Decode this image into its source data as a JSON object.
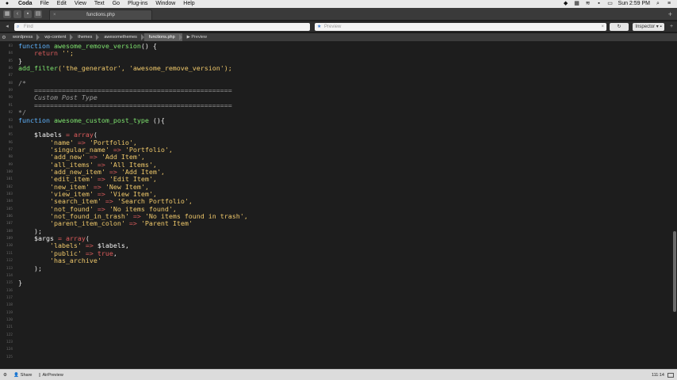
{
  "menubar": {
    "apple": "",
    "items": [
      "Coda",
      "File",
      "Edit",
      "View",
      "Text",
      "Go",
      "Plug-ins",
      "Window",
      "Help"
    ],
    "clock": "Sun 2:59 PM"
  },
  "tabbar": {
    "tab_label": "functions.php",
    "plus": "+"
  },
  "searchbar": {
    "find_placeholder": "Find",
    "preview_placeholder": "Preview",
    "button_label": "Inspector ▾ ▪",
    "plus": "+"
  },
  "breadcrumb": {
    "items": [
      "wordpress",
      "wp-content",
      "themes",
      "awesomethemes",
      "functions.php"
    ],
    "preview_label": "Preview"
  },
  "editor": {
    "line_numbers": [
      "83",
      "84",
      "85",
      "86",
      "87",
      "88",
      "89",
      "90",
      "91",
      "92",
      "93",
      "94",
      "95",
      "96",
      "97",
      "98",
      "99",
      "100",
      "101",
      "102",
      "103",
      "104",
      "105",
      "106",
      "107",
      "108",
      "109",
      "110",
      "111",
      "112",
      "113",
      "114",
      "115",
      "116",
      "117",
      "118",
      "119",
      "120",
      "121",
      "122",
      "123",
      "124",
      "125"
    ],
    "code_lines": [
      [
        {
          "t": "function ",
          "c": "kw"
        },
        {
          "t": "awesome_remove_version",
          "c": "fn"
        },
        {
          "t": "() {",
          "c": "pl"
        }
      ],
      [
        {
          "t": "    return ",
          "c": "op"
        },
        {
          "t": "'';",
          "c": "str"
        }
      ],
      [
        {
          "t": "}",
          "c": "pl"
        }
      ],
      [
        {
          "t": "add_filter",
          "c": "fn"
        },
        {
          "t": "('the_generator', 'awesome_remove_version');",
          "c": "str"
        }
      ],
      [],
      [
        {
          "t": "/*",
          "c": "cm"
        }
      ],
      [
        {
          "t": "    ==================================================",
          "c": "cm"
        }
      ],
      [
        {
          "t": "    Custom Post Type",
          "c": "cm-i"
        }
      ],
      [
        {
          "t": "    ==================================================",
          "c": "cm"
        }
      ],
      [
        {
          "t": "*/",
          "c": "cm"
        }
      ],
      [
        {
          "t": "function ",
          "c": "kw"
        },
        {
          "t": "awesome_custom_post_type ",
          "c": "fn"
        },
        {
          "t": "(){",
          "c": "pl"
        }
      ],
      [],
      [
        {
          "t": "    $labels ",
          "c": "var"
        },
        {
          "t": "= array",
          "c": "arr"
        },
        {
          "t": "(",
          "c": "pl"
        }
      ],
      [
        {
          "t": "        'name' ",
          "c": "str"
        },
        {
          "t": "=> ",
          "c": "op"
        },
        {
          "t": "'Portfolio',",
          "c": "str"
        }
      ],
      [
        {
          "t": "        'singular_name' ",
          "c": "str"
        },
        {
          "t": "=> ",
          "c": "op"
        },
        {
          "t": "'Portfolio',",
          "c": "str"
        }
      ],
      [
        {
          "t": "        'add_new' ",
          "c": "str"
        },
        {
          "t": "=> ",
          "c": "op"
        },
        {
          "t": "'Add Item',",
          "c": "str"
        }
      ],
      [
        {
          "t": "        'all_items' ",
          "c": "str"
        },
        {
          "t": "=> ",
          "c": "op"
        },
        {
          "t": "'All Items',",
          "c": "str"
        }
      ],
      [
        {
          "t": "        'add_new_item' ",
          "c": "str"
        },
        {
          "t": "=> ",
          "c": "op"
        },
        {
          "t": "'Add Item',",
          "c": "str"
        }
      ],
      [
        {
          "t": "        'edit_item' ",
          "c": "str"
        },
        {
          "t": "=> ",
          "c": "op"
        },
        {
          "t": "'Edit Item',",
          "c": "str"
        }
      ],
      [
        {
          "t": "        'new_item' ",
          "c": "str"
        },
        {
          "t": "=> ",
          "c": "op"
        },
        {
          "t": "'New Item',",
          "c": "str"
        }
      ],
      [
        {
          "t": "        'view_item' ",
          "c": "str"
        },
        {
          "t": "=> ",
          "c": "op"
        },
        {
          "t": "'View Item',",
          "c": "str"
        }
      ],
      [
        {
          "t": "        'search_item' ",
          "c": "str"
        },
        {
          "t": "=> ",
          "c": "op"
        },
        {
          "t": "'Search Portfolio',",
          "c": "str"
        }
      ],
      [
        {
          "t": "        'not_found' ",
          "c": "str"
        },
        {
          "t": "=> ",
          "c": "op"
        },
        {
          "t": "'No items found',",
          "c": "str"
        }
      ],
      [
        {
          "t": "        'not_found_in_trash' ",
          "c": "str"
        },
        {
          "t": "=> ",
          "c": "op"
        },
        {
          "t": "'No items found in trash',",
          "c": "str"
        }
      ],
      [
        {
          "t": "        'parent_item_colon' ",
          "c": "str"
        },
        {
          "t": "=> ",
          "c": "op"
        },
        {
          "t": "'Parent Item'",
          "c": "str"
        }
      ],
      [
        {
          "t": "    );",
          "c": "pl"
        }
      ],
      [
        {
          "t": "    $args ",
          "c": "var"
        },
        {
          "t": "= array",
          "c": "arr"
        },
        {
          "t": "(",
          "c": "pl"
        }
      ],
      [
        {
          "t": "        'labels' ",
          "c": "str"
        },
        {
          "t": "=> ",
          "c": "op"
        },
        {
          "t": "$labels,",
          "c": "var"
        }
      ],
      [
        {
          "t": "        'public' ",
          "c": "str"
        },
        {
          "t": "=> ",
          "c": "op"
        },
        {
          "t": "true",
          "c": "tru"
        },
        {
          "t": ",",
          "c": "pl"
        }
      ],
      [
        {
          "t": "        'has_archive'",
          "c": "str"
        }
      ],
      [
        {
          "t": "    );",
          "c": "pl"
        }
      ],
      [],
      [
        {
          "t": "}",
          "c": "pl"
        }
      ]
    ]
  },
  "statusbar": {
    "share_label": "Share",
    "airpreview_label": "AirPreview",
    "position": "111:14"
  },
  "colors": {
    "keyword": "#5fb4ff",
    "function": "#7ee36e",
    "string": "#f0c96b",
    "operator": "#d85b5b",
    "comment": "#9a9a9a"
  }
}
